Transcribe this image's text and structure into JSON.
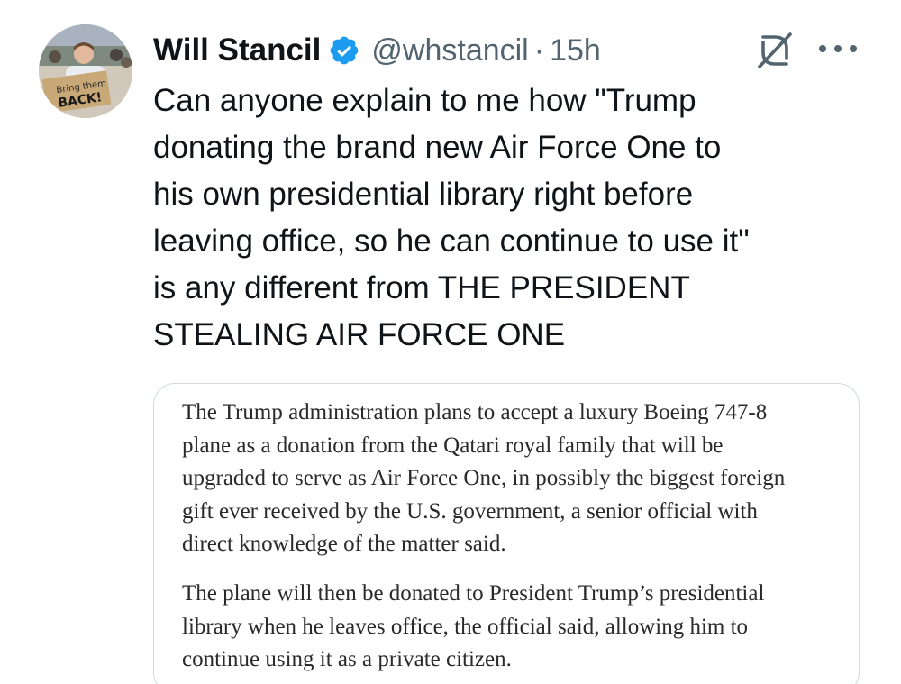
{
  "author": {
    "display_name": "Will Stancil",
    "handle": "@whstancil",
    "separator": "·",
    "timestamp": "15h",
    "verified_color": "#1d9bf0",
    "avatar_sign_line1": "Bring them",
    "avatar_sign_line2": "BACK!"
  },
  "tweet": {
    "text_lines": [
      "Can anyone explain to me how \"Trump",
      "donating the brand new Air Force One to",
      "his own presidential library right before",
      "leaving office, so he can continue to use it\"",
      "is any different from THE PRESIDENT",
      "STEALING AIR FORCE ONE"
    ]
  },
  "quote": {
    "paragraph1_lines": [
      "The Trump administration plans to accept a luxury Boeing 747-8",
      "plane as a donation from the Qatari royal family that will be",
      "upgraded to serve as Air Force One, in possibly the biggest foreign",
      "gift ever received by the U.S. government, a senior official with",
      "direct knowledge of the matter said."
    ],
    "paragraph2_lines": [
      "The plane will then be donated to President Trump’s presidential",
      "library when he leaves office, the official said, allowing him to",
      "continue using it as a private citizen."
    ]
  },
  "icons": {
    "verified": "verified-badge-icon",
    "grok": "grok-icon",
    "more": "more-options-icon"
  },
  "colors": {
    "text_primary": "#0f1419",
    "text_secondary": "#536471",
    "accent": "#1d9bf0",
    "border": "#cfd9de"
  }
}
